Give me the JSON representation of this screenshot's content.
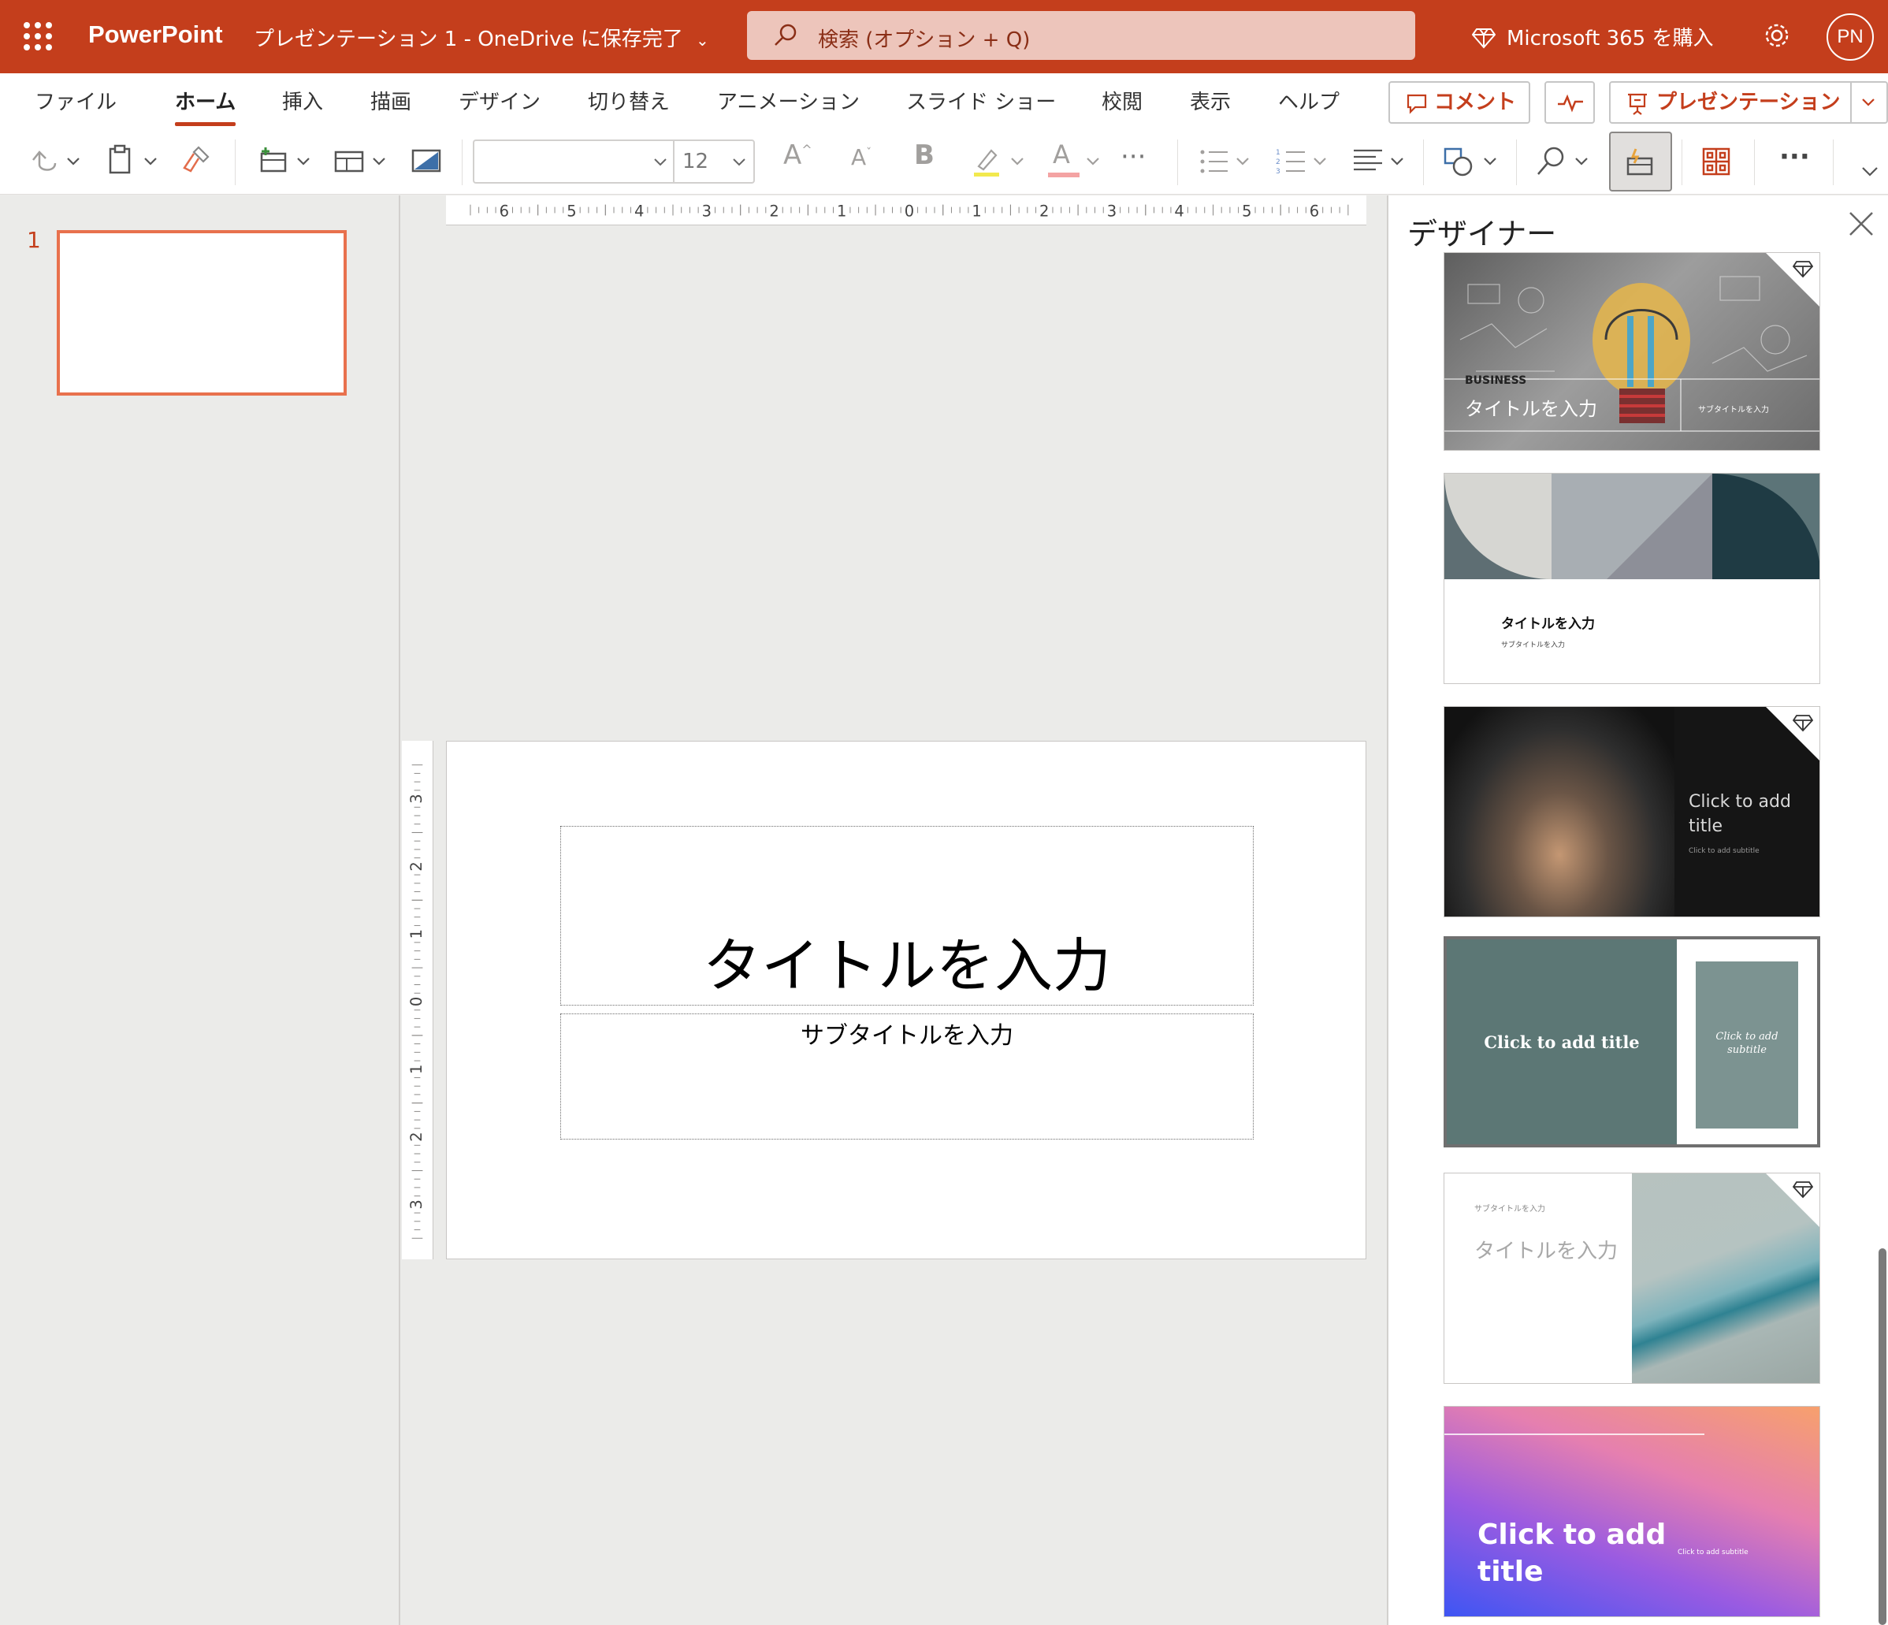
{
  "app": {
    "name": "PowerPoint",
    "document": "プレゼンテーション 1",
    "separator": "-",
    "save_status": "OneDrive に保存完了",
    "search_placeholder": "検索 (オプション + Q)",
    "buy_label": "Microsoft 365 を購入",
    "user_initials": "PN",
    "brand_color": "#c43e1c"
  },
  "menu": {
    "tabs": [
      "ファイル",
      "ホーム",
      "挿入",
      "描画",
      "デザイン",
      "切り替え",
      "アニメーション",
      "スライド ショー",
      "校閲",
      "表示",
      "ヘルプ"
    ],
    "active_tab": "ホーム",
    "comment_label": "コメント",
    "present_label": "プレゼンテーション"
  },
  "toolbar": {
    "font_name": "",
    "font_size": "12",
    "grow_font_glyph": "A",
    "shrink_font_glyph": "A",
    "bold_glyph": "B",
    "font_color_glyph": "A",
    "more_glyph": "···"
  },
  "ruler": {
    "horizontal_labels": [
      "6",
      "5",
      "4",
      "3",
      "2",
      "1",
      "0",
      "1",
      "2",
      "3",
      "4",
      "5",
      "6"
    ],
    "vertical_labels": [
      "3",
      "2",
      "1",
      "0",
      "1",
      "2",
      "3"
    ]
  },
  "thumbnails": {
    "slide_numbers": [
      "1"
    ]
  },
  "slide": {
    "title_placeholder": "タイトルを入力",
    "subtitle_placeholder": "サブタイトルを入力"
  },
  "designer": {
    "title": "デザイナー",
    "cards": [
      {
        "style": "business-sketch",
        "premium": true,
        "kicker": "BUSINESS",
        "title": "タイトルを入力",
        "subtitle": "サブタイトルを入力"
      },
      {
        "style": "geometric",
        "premium": false,
        "title": "タイトルを入力",
        "subtitle": "サブタイトルを入力"
      },
      {
        "style": "smoke",
        "premium": true,
        "title": "Click to add title",
        "subtitle": "Click to add subtitle"
      },
      {
        "style": "teal-frame",
        "premium": false,
        "selected": true,
        "title": "Click to add title",
        "subtitle": "Click to add subtitle"
      },
      {
        "style": "silk",
        "premium": true,
        "title": "タイトルを入力",
        "subtitle": "サブタイトルを入力"
      },
      {
        "style": "gradient",
        "premium": false,
        "title": "Click to add title",
        "subtitle": "Click to add subtitle"
      }
    ]
  }
}
